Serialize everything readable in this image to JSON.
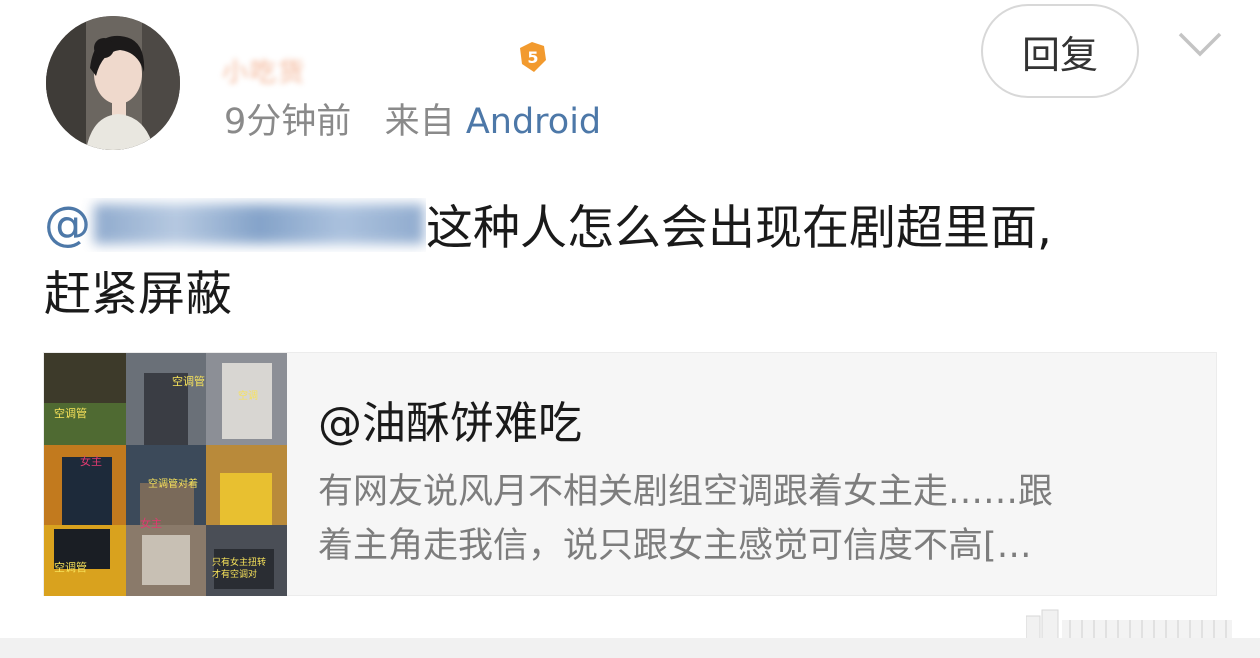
{
  "post": {
    "username": "小吃货",
    "time_ago": "9分钟前",
    "source_prefix": "来自",
    "source": "Android",
    "reply_label": "回复",
    "mention_at": "@",
    "text_after_mention": "这种人怎么会出现在剧超里面,",
    "text_line2": "赶紧屏蔽"
  },
  "quoted_card": {
    "title": "@油酥饼难吃",
    "desc_line1": "有网友说风月不相关剧组空调跟着女主走……跟",
    "desc_line2": "着主角走我信，说只跟女主感觉可信度不高[…",
    "thumb_labels": [
      "空调管",
      "空调管",
      "空调",
      "女主",
      "空调管对着",
      "女主",
      "空调管",
      "只有女主扭转",
      "才有空调对"
    ]
  },
  "colors": {
    "link_blue": "#4d78a8",
    "meta_gray": "#8a8a8a",
    "card_bg": "#f6f6f6"
  },
  "icons": {
    "chevron": "chevron-down-icon",
    "vip": "vip-badge-icon"
  }
}
